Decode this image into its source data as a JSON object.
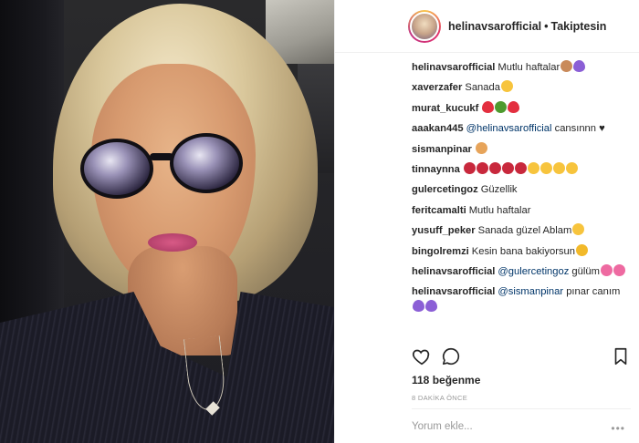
{
  "post": {
    "author": "helinavsarofficial",
    "separator": "•",
    "follow_status": "Takiptesin"
  },
  "comments": [
    {
      "user": "helinavsarofficial",
      "text": "Mutlu haftalar",
      "emojis": [
        "old-person-emoji",
        "purple-heart-emoji"
      ]
    },
    {
      "user": "xaverzafer",
      "text": "Sanada",
      "emojis": [
        "smiling-face-emoji"
      ]
    },
    {
      "user": "murat_kucukf",
      "text": "",
      "emojis": [
        "red-heart-emoji",
        "tree-emoji",
        "red-heart-emoji"
      ]
    },
    {
      "user": "aaakan445",
      "mention": "@helinavsarofficial",
      "text": "cansınnn ♥",
      "emojis": []
    },
    {
      "user": "sismanpinar",
      "text": "",
      "emojis": [
        "peach-emoji"
      ]
    },
    {
      "user": "tinnaynna",
      "text": "",
      "emojis": [
        "rose-emoji",
        "rose-emoji",
        "rose-emoji",
        "rose-emoji",
        "rose-emoji",
        "smiling-face-emoji",
        "smiling-face-emoji",
        "smiling-face-emoji",
        "smiling-face-emoji"
      ]
    },
    {
      "user": "gulercetingoz",
      "text": "Güzellik",
      "emojis": []
    },
    {
      "user": "feritcamalti",
      "text": "Mutlu haftalar",
      "emojis": []
    },
    {
      "user": "yusuff_peker",
      "text": "Sanada güzel Ablam",
      "emojis": [
        "smiling-face-emoji"
      ]
    },
    {
      "user": "bingolremzi",
      "text": "Kesin bana bakiyorsun",
      "emojis": [
        "grinning-face-emoji"
      ]
    },
    {
      "user": "helinavsarofficial",
      "mention": "@gulercetingoz",
      "text": "gülüm",
      "emojis": [
        "hibiscus-emoji",
        "hibiscus-emoji"
      ]
    },
    {
      "user": "helinavsarofficial",
      "mention": "@sismanpinar",
      "text": "pınar canım",
      "emojis": [
        "purple-heart-emoji",
        "purple-heart-emoji"
      ]
    }
  ],
  "actions": {
    "like_icon": "heart-icon",
    "comment_icon": "comment-bubble-icon",
    "save_icon": "bookmark-icon"
  },
  "likes": "118 beğenme",
  "timestamp": "8 DAKİKA ÖNCE",
  "comment_box": {
    "placeholder": "Yorum ekle...",
    "more": "•••"
  },
  "colors": {
    "text": "#262626",
    "mention": "#003569",
    "muted": "#999999",
    "divider": "#efefef"
  }
}
